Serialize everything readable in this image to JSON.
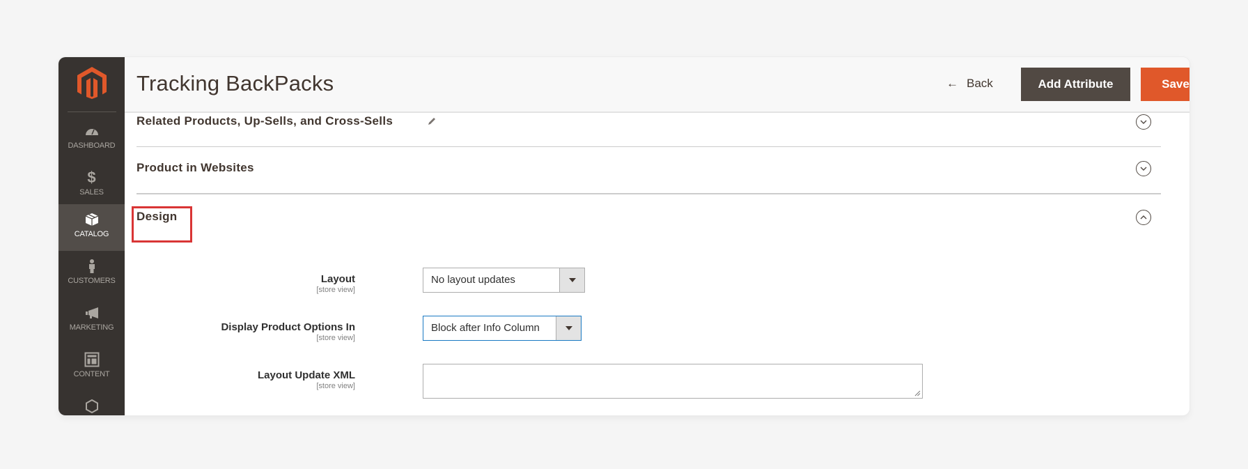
{
  "colors": {
    "sidebar_bg": "#373330",
    "sidebar_active": "#524d49",
    "brand_orange": "#e0582a",
    "add_attribute_bg": "#514943",
    "highlight_red": "#d93535",
    "focus_blue": "#1979c3"
  },
  "sidebar": {
    "logo": "magento-logo",
    "items": [
      {
        "label": "DASHBOARD",
        "icon": "dashboard-gauge-icon",
        "active": false
      },
      {
        "label": "SALES",
        "icon": "dollar-icon",
        "active": false
      },
      {
        "label": "CATALOG",
        "icon": "box-icon",
        "active": true
      },
      {
        "label": "CUSTOMERS",
        "icon": "person-icon",
        "active": false
      },
      {
        "label": "MARKETING",
        "icon": "megaphone-icon",
        "active": false
      },
      {
        "label": "CONTENT",
        "icon": "layout-icon",
        "active": false
      },
      {
        "label": "",
        "icon": "hexagon-icon",
        "active": false
      }
    ]
  },
  "header": {
    "title": "Tracking BackPacks",
    "back_label": "Back",
    "add_attribute_label": "Add Attribute",
    "save_label": "Save"
  },
  "sections": [
    {
      "title": "Related Products, Up-Sells, and Cross-Sells",
      "editable": true,
      "state": "collapsed"
    },
    {
      "title": "Product in Websites",
      "editable": false,
      "state": "collapsed"
    },
    {
      "title": "Design",
      "editable": false,
      "state": "expanded",
      "highlighted": true
    }
  ],
  "design_form": {
    "layout": {
      "label": "Layout",
      "scope": "[store view]",
      "value": "No layout updates"
    },
    "display_options": {
      "label": "Display Product Options In",
      "scope": "[store view]",
      "value": "Block after Info Column"
    },
    "layout_xml": {
      "label": "Layout Update XML",
      "scope": "[store view]",
      "value": ""
    }
  }
}
